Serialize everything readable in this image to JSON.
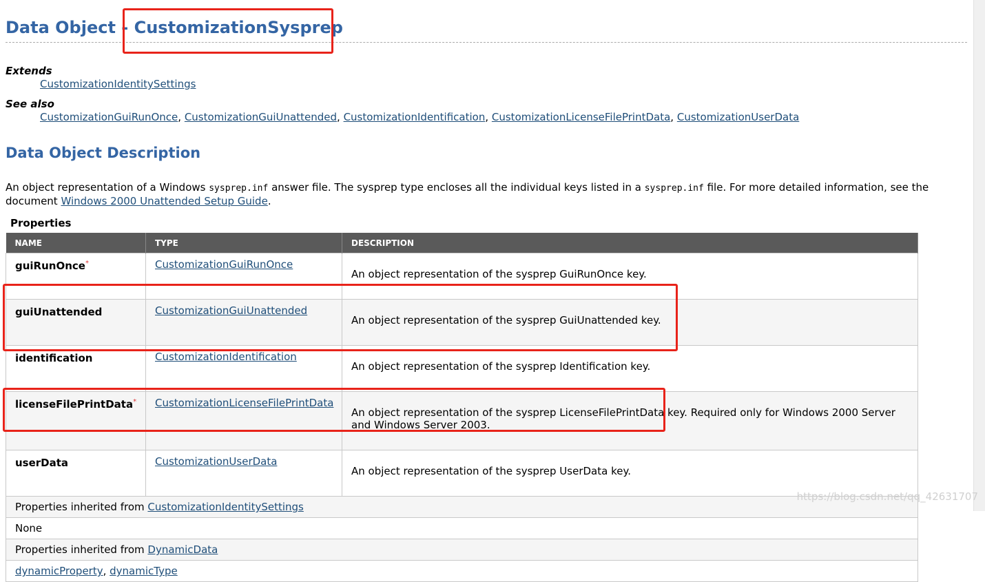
{
  "page": {
    "title_prefix": "Data Object - ",
    "title_name": "CustomizationSysprep"
  },
  "extends": {
    "label": "Extends",
    "link": "CustomizationIdentitySettings"
  },
  "see_also": {
    "label": "See also",
    "links": [
      "CustomizationGuiRunOnce",
      "CustomizationGuiUnattended",
      "CustomizationIdentification",
      "CustomizationLicenseFilePrintData",
      "CustomizationUserData"
    ]
  },
  "description": {
    "heading": "Data Object Description",
    "text_1": "An object representation of a Windows ",
    "code_1": "sysprep.inf",
    "text_2": " answer file. The sysprep type encloses all the individual keys listed in a ",
    "code_2": "sysprep.inf",
    "text_3": " file. For more detailed information, see the document ",
    "link": "Windows 2000 Unattended Setup Guide",
    "text_4": "."
  },
  "properties": {
    "caption": "Properties",
    "columns": [
      "NAME",
      "TYPE",
      "DESCRIPTION"
    ],
    "rows": [
      {
        "name": "guiRunOnce",
        "required": "*",
        "type": "CustomizationGuiRunOnce",
        "description": "An object representation of the sysprep GuiRunOnce key."
      },
      {
        "name": "guiUnattended",
        "required": "",
        "type": "CustomizationGuiUnattended",
        "description": "An object representation of the sysprep GuiUnattended key."
      },
      {
        "name": "identification",
        "required": "",
        "type": "CustomizationIdentification",
        "description": "An object representation of the sysprep Identification key."
      },
      {
        "name": "licenseFilePrintData",
        "required": "*",
        "type": "CustomizationLicenseFilePrintData",
        "description": "An object representation of the sysprep LicenseFilePrintData key. Required only for Windows 2000 Server and Windows Server 2003."
      },
      {
        "name": "userData",
        "required": "",
        "type": "CustomizationUserData",
        "description": "An object representation of the sysprep UserData key."
      }
    ],
    "inherited_1_label": "Properties inherited from ",
    "inherited_1_link": "CustomizationIdentitySettings",
    "inherited_1_value": "None",
    "inherited_2_label": "Properties inherited from ",
    "inherited_2_link": "DynamicData",
    "inherited_2_links": [
      "dynamicProperty",
      "dynamicType"
    ]
  },
  "watermark": "https://blog.csdn.net/qq_42631707",
  "colors": {
    "heading": "#3465a4",
    "link": "#1f4e79",
    "table_header": "#5a5a5a",
    "highlight": "#e8231a"
  }
}
